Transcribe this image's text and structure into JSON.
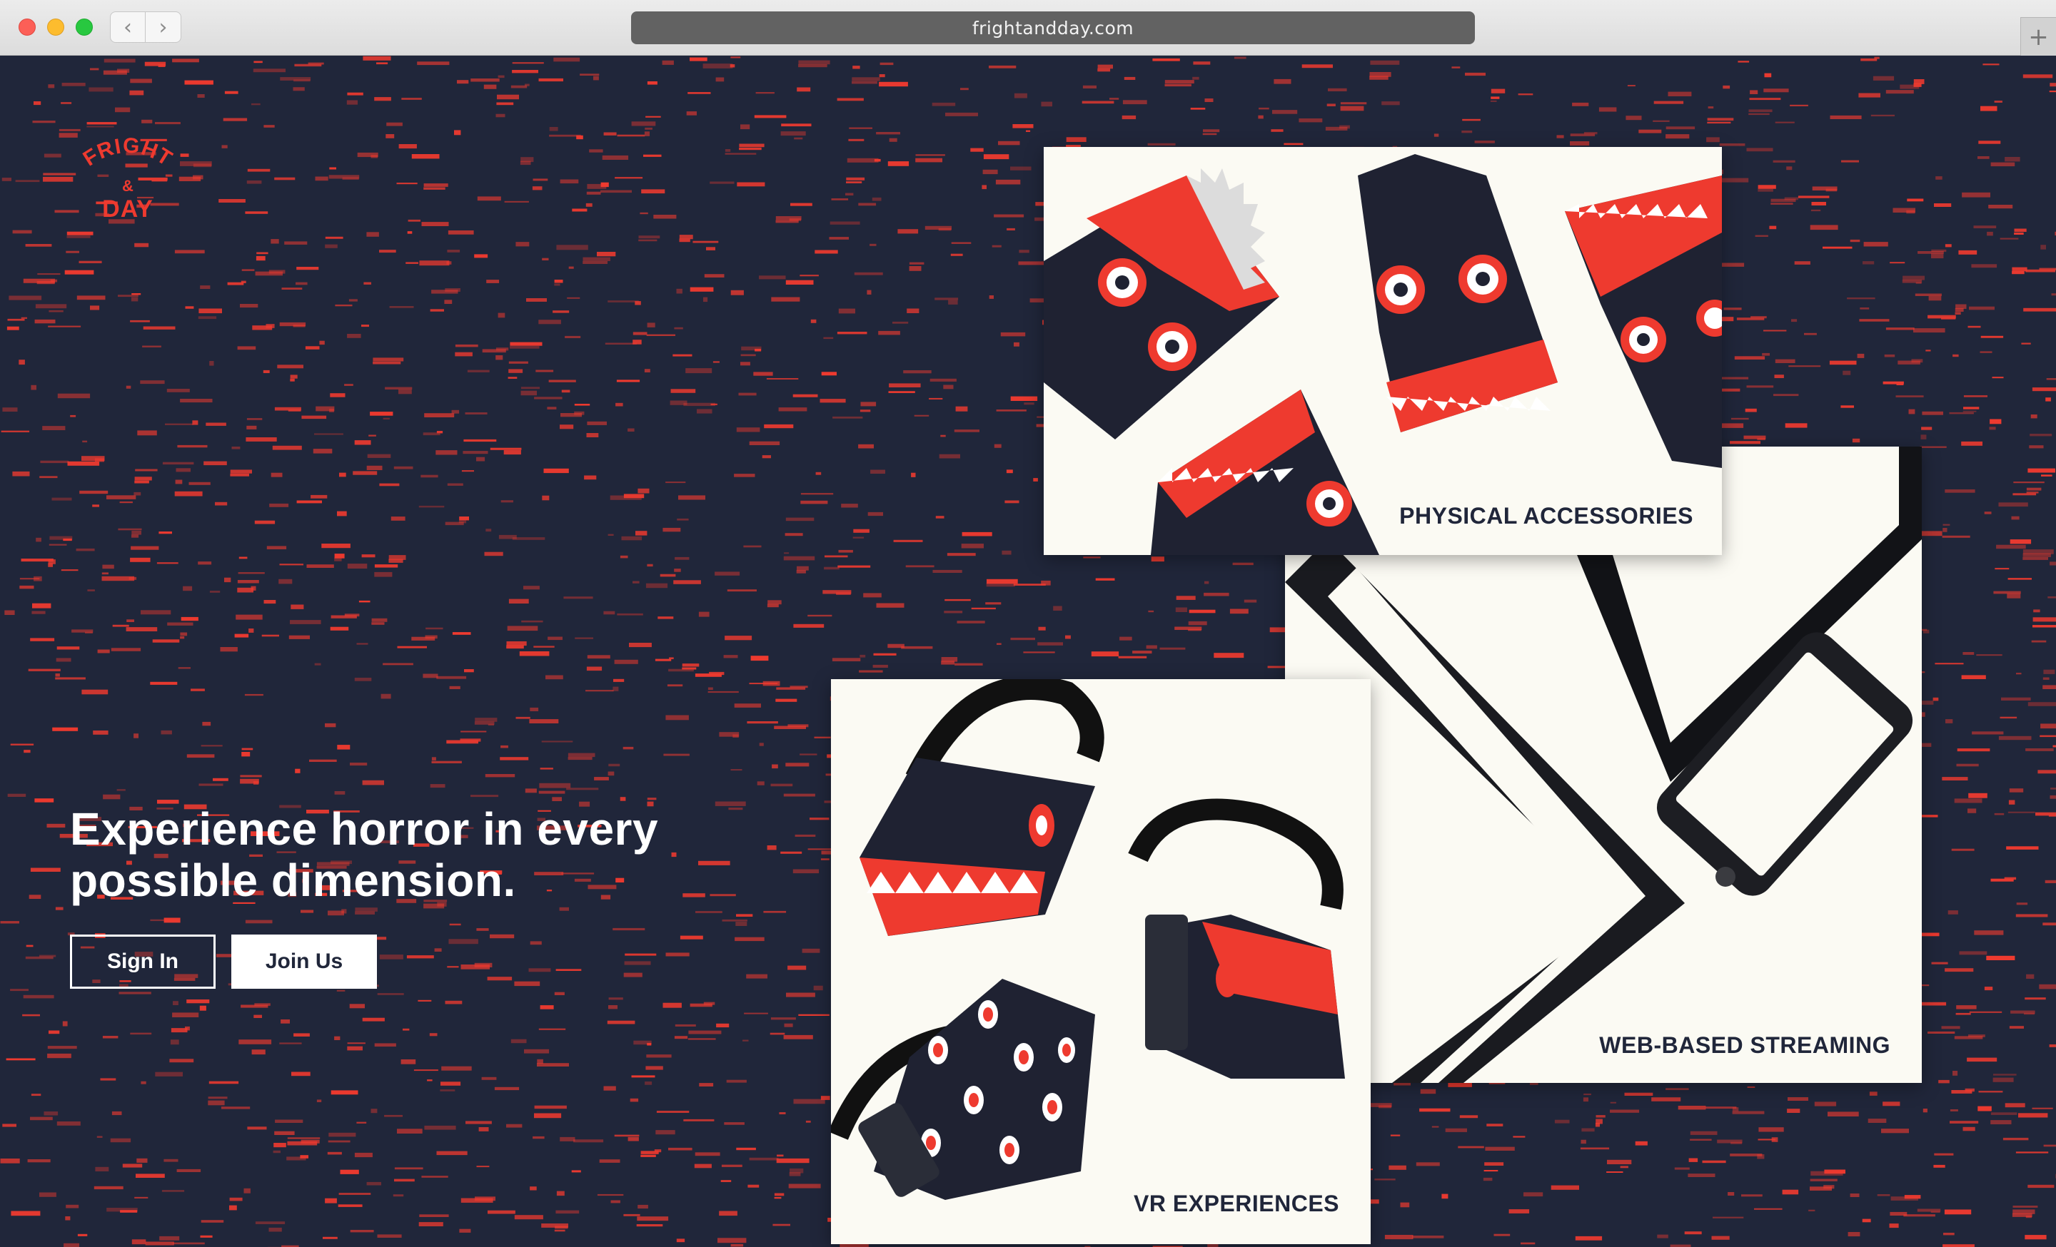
{
  "browser": {
    "url": "frightandday.com",
    "back_icon": "chevron-left-icon",
    "forward_icon": "chevron-right-icon",
    "new_tab_icon": "plus-icon"
  },
  "brand": {
    "logo_line1": "FRIGHT",
    "logo_line2": "&",
    "logo_line3": "DAY",
    "accent_color": "#ee3a2f",
    "background_color": "#20263a"
  },
  "hero": {
    "title_line1": "Experience horror in every",
    "title_line2": "possible dimension.",
    "sign_in_label": "Sign In",
    "join_label": "Join Us"
  },
  "cards": {
    "physical": {
      "label": "PHYSICAL ACCESSORIES"
    },
    "web": {
      "label": "WEB-BASED STREAMING"
    },
    "vr": {
      "label": "VR EXPERIENCES"
    }
  }
}
